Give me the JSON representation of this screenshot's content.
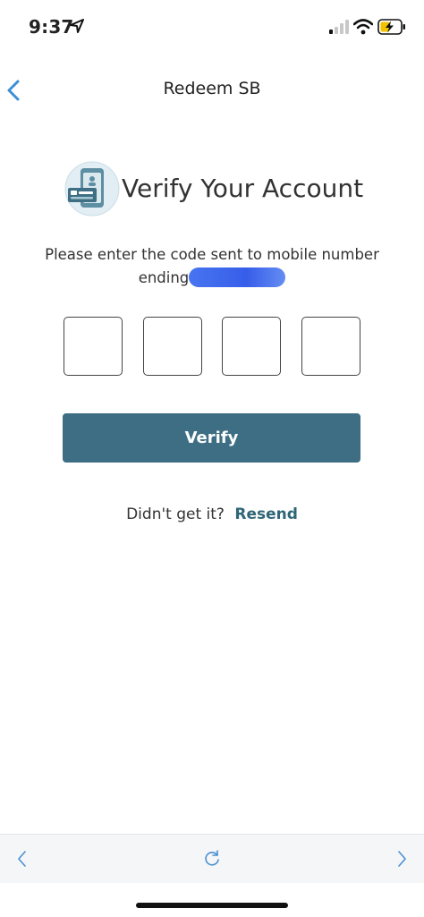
{
  "status_bar": {
    "time": "9:37",
    "icons": [
      "location-arrow-icon",
      "cellular-signal-icon",
      "wifi-icon",
      "battery-charging-icon"
    ]
  },
  "nav": {
    "title": "Redeem SB",
    "back_icon": "chevron-left-icon"
  },
  "hero": {
    "icon": "phone-id-card-icon",
    "title": "Verify Your Account"
  },
  "instructions": {
    "line1": "Please enter the code sent to mobile number",
    "line2": "ending"
  },
  "code_inputs": [
    "",
    "",
    "",
    ""
  ],
  "verify_button": {
    "label": "Verify"
  },
  "resend": {
    "prompt": "Didn't get it?",
    "link_label": "Resend"
  },
  "browser_bar": {
    "icons": [
      "back-arrow-icon",
      "reload-icon",
      "forward-arrow-icon"
    ]
  },
  "colors": {
    "accent": "#3e6e84",
    "link": "#2f6677",
    "nav_chevron": "#3b8fd6"
  }
}
